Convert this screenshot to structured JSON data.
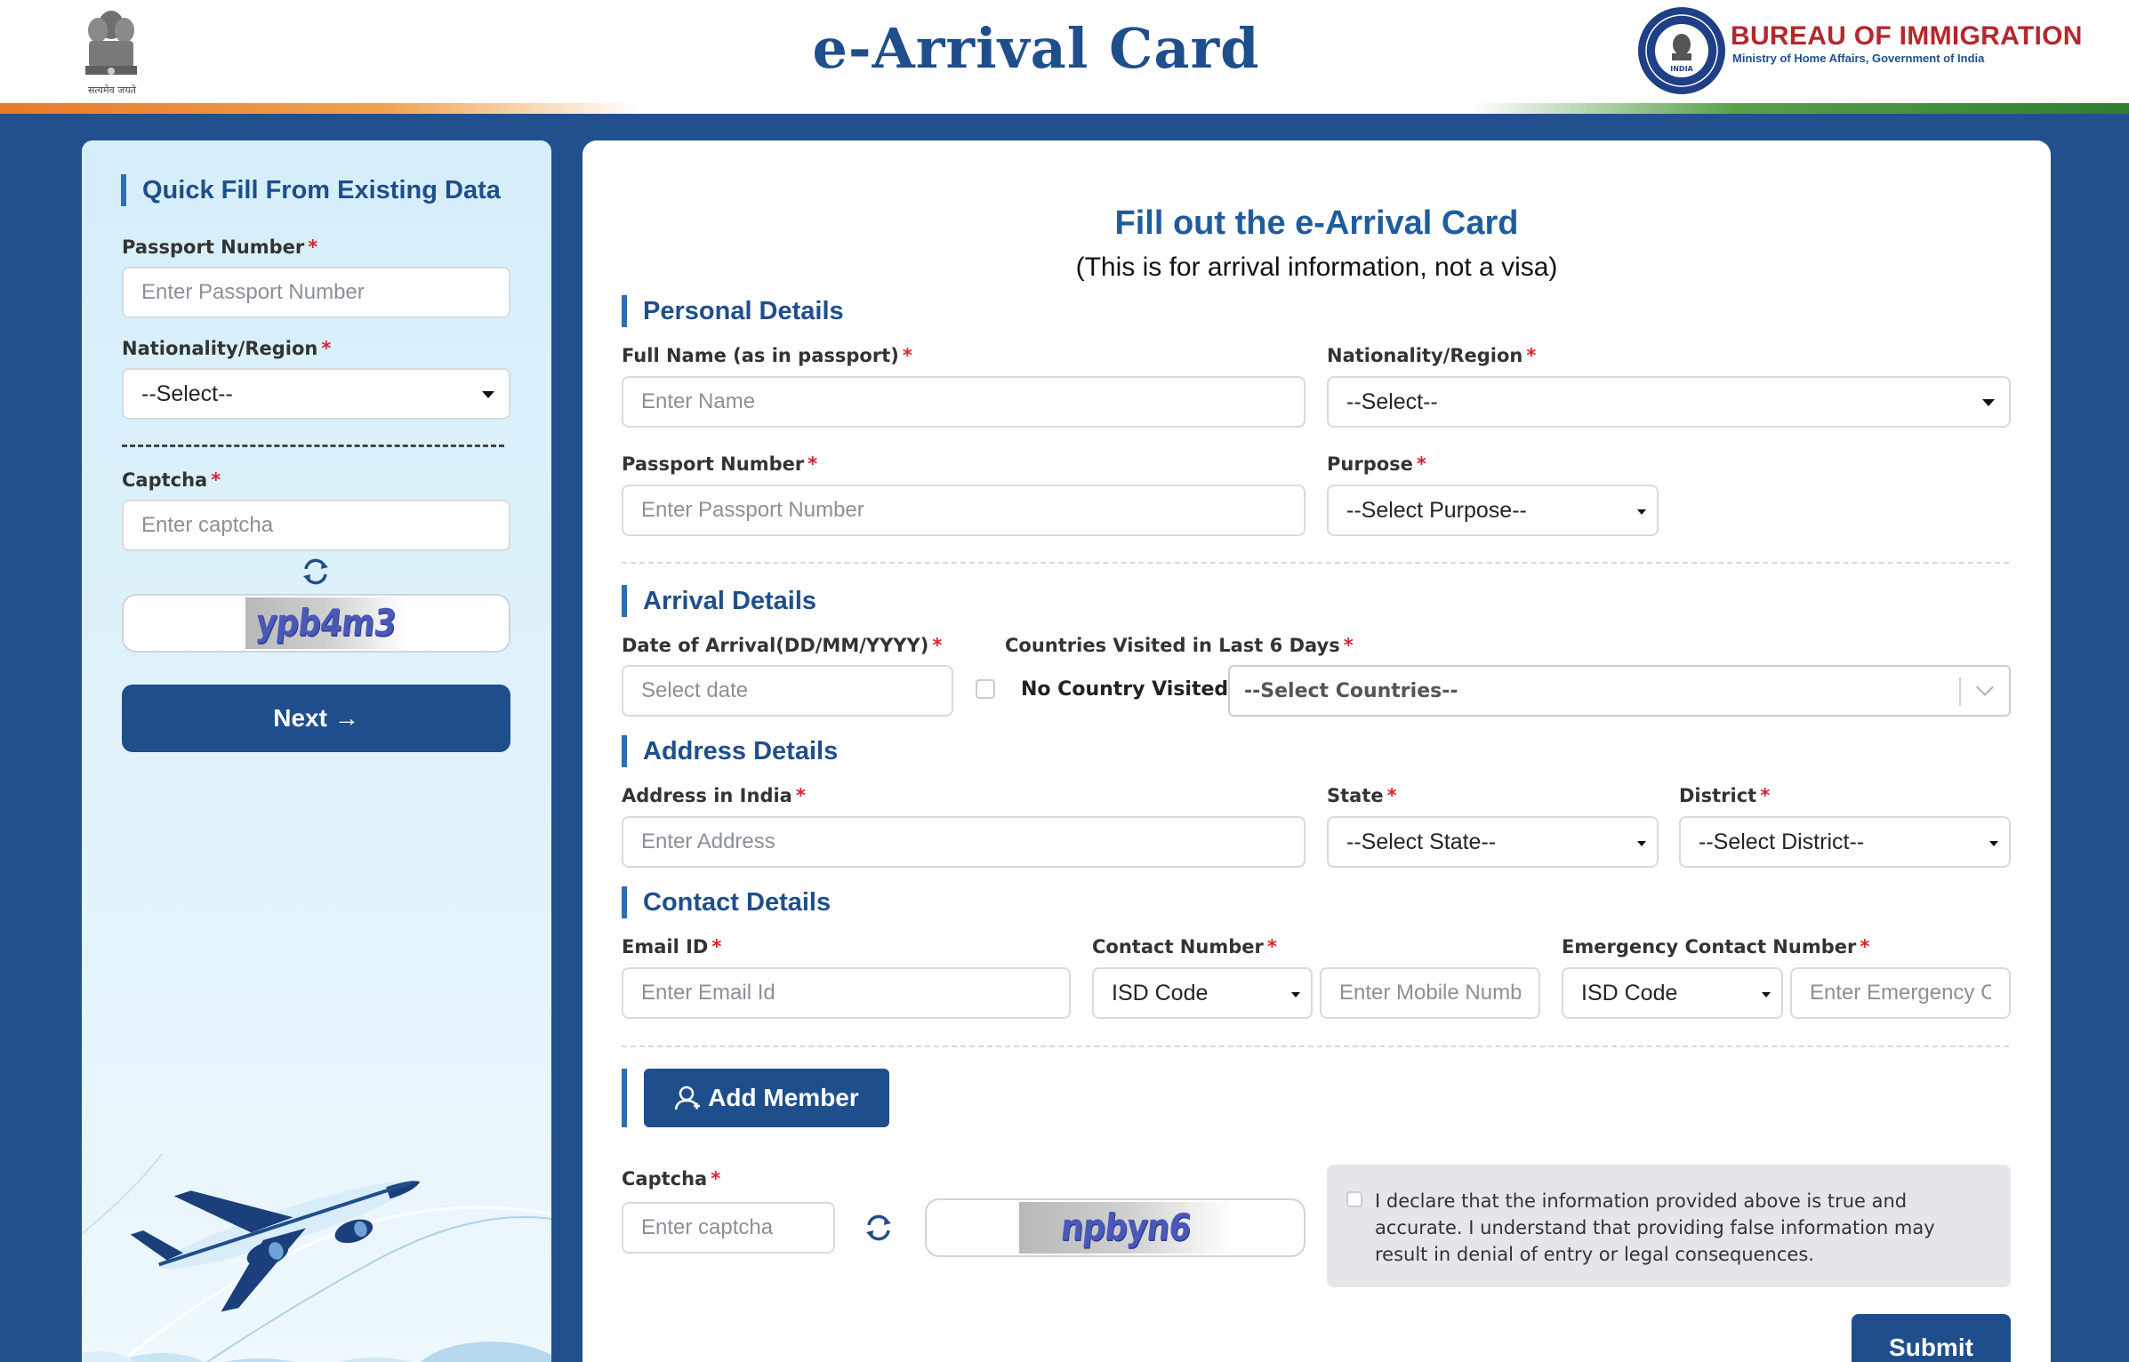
{
  "header": {
    "title": "e-Arrival Card",
    "emblem_caption": "सत्यमेव जयते",
    "bureau_title": "BUREAU OF IMMIGRATION",
    "bureau_subtitle": "Ministry of Home Affairs, Government of India",
    "seal_text": "INDIA"
  },
  "quick_fill": {
    "heading": "Quick Fill From Existing Data",
    "passport_label": "Passport Number",
    "passport_placeholder": "Enter Passport Number",
    "nationality_label": "Nationality/Region",
    "nationality_value": "--Select--",
    "captcha_label": "Captcha",
    "captcha_placeholder": "Enter captcha",
    "captcha_text": "ypb4m3",
    "next_label": "Next →",
    "required_mark": "*"
  },
  "form": {
    "title": "Fill out the e-Arrival Card",
    "subtitle": "(This is for arrival information, not a visa)",
    "required_mark": "*",
    "personal": {
      "heading": "Personal Details",
      "full_name_label": "Full Name (as in passport)",
      "full_name_placeholder": "Enter Name",
      "nationality_label": "Nationality/Region",
      "nationality_value": "--Select--",
      "passport_label": "Passport Number",
      "passport_placeholder": "Enter Passport Number",
      "purpose_label": "Purpose",
      "purpose_value": "--Select Purpose--"
    },
    "arrival": {
      "heading": "Arrival Details",
      "date_label": "Date of Arrival(DD/MM/YYYY)",
      "date_placeholder": "Select date",
      "countries_label": "Countries Visited in Last 6 Days",
      "no_country_label": "No Country Visited",
      "countries_value": "--Select Countries--"
    },
    "address": {
      "heading": "Address Details",
      "address_label": "Address in India",
      "address_placeholder": "Enter Address",
      "state_label": "State",
      "state_value": "--Select State--",
      "district_label": "District",
      "district_value": "--Select District--"
    },
    "contact": {
      "heading": "Contact Details",
      "email_label": "Email ID",
      "email_placeholder": "Enter Email Id",
      "contact_label": "Contact Number",
      "isd_value": "ISD Code",
      "mobile_placeholder": "Enter Mobile Number",
      "emergency_label": "Emergency Contact Number",
      "emergency_isd_value": "ISD Code",
      "emergency_placeholder": "Enter Emergency Contact"
    },
    "add_member_label": "Add Member",
    "captcha_label": "Captcha",
    "captcha_placeholder": "Enter captcha",
    "captcha_text": "npbyn6",
    "declaration": "I declare that the information provided above is true and accurate. I understand that providing false information may result in denial of entry or legal consequences.",
    "submit_label": "Submit"
  },
  "colors": {
    "primary": "#1f4e8c",
    "background": "#22508f",
    "required": "#d9232e",
    "bureau_red": "#b3282d"
  },
  "icons": [
    "emblem-icon",
    "bureau-seal-icon",
    "refresh-icon",
    "arrow-right-icon",
    "user-add-icon",
    "chevron-down-icon",
    "airplane-illustration"
  ]
}
